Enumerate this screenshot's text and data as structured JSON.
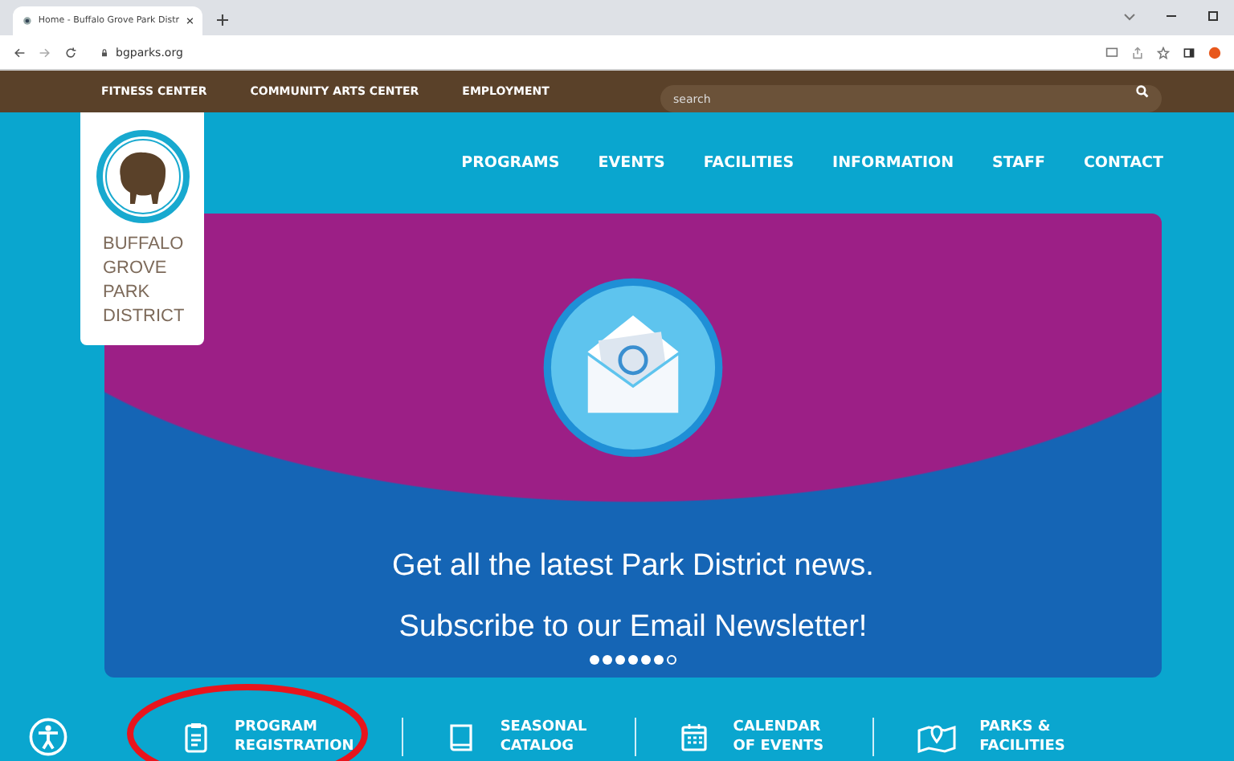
{
  "browser": {
    "tab_title": "Home - Buffalo Grove Park Distr",
    "url": "bgparks.org"
  },
  "utility_nav": [
    "FITNESS CENTER",
    "COMMUNITY ARTS CENTER",
    "EMPLOYMENT"
  ],
  "search": {
    "placeholder": "search"
  },
  "logo": {
    "lines": [
      "BUFFALO",
      "GROVE",
      "PARK",
      "DISTRICT"
    ]
  },
  "main_nav": [
    "PROGRAMS",
    "EVENTS",
    "FACILITIES",
    "INFORMATION",
    "STAFF",
    "CONTACT"
  ],
  "banner": {
    "lines": [
      "Get all the latest Park District news.",
      "Subscribe to our Email Newsletter!"
    ],
    "dots": [
      {
        "selected": false
      },
      {
        "selected": false
      },
      {
        "selected": false
      },
      {
        "selected": false
      },
      {
        "selected": false
      },
      {
        "selected": false
      },
      {
        "selected": true
      }
    ]
  },
  "quick_links": [
    {
      "kind": "clipboard",
      "lines": [
        "PROGRAM",
        "REGISTRATION"
      ]
    },
    {
      "kind": "book",
      "lines": [
        "SEASONAL",
        "CATALOG"
      ]
    },
    {
      "kind": "calendar",
      "lines": [
        "CALENDAR",
        "OF EVENTS"
      ]
    },
    {
      "kind": "map",
      "lines": [
        "PARKS &",
        "FACILITIES"
      ]
    }
  ]
}
